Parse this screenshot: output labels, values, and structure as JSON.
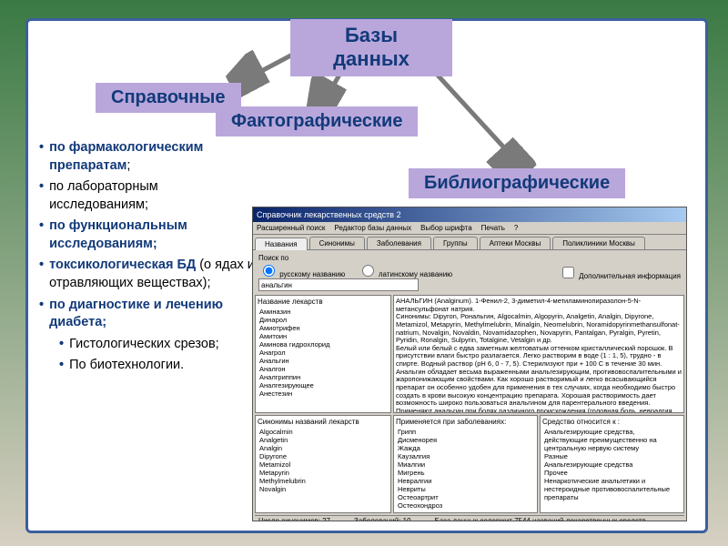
{
  "root": "Базы данных",
  "branches": {
    "reference": "Справочные",
    "fact": "Фактографические",
    "biblio": "Библиографические"
  },
  "bullets": [
    {
      "lead": "по фармакологическим препаратам",
      "tail": ";",
      "bold": true
    },
    {
      "lead": "",
      "tail": "по лабораторным исследованиям;",
      "bold": false
    },
    {
      "lead": "по функциональным исследованиям;",
      "tail": "",
      "bold": true
    },
    {
      "lead": "токсикологическая БД",
      "tail": " (о ядах и отравляющих веществах);",
      "bold": true
    },
    {
      "lead": "по диагностике и лечению диабета;",
      "tail": "",
      "bold": true
    }
  ],
  "sub_bullets": [
    "Гистологических срезов;",
    "По биотехнологии."
  ],
  "app": {
    "title": "Справочник лекарственных средств 2",
    "menu": [
      "Расширенный поиск",
      "Редактор базы данных",
      "Выбор шрифта",
      "Печать",
      "?"
    ],
    "tabs": [
      "Названия",
      "Синонимы",
      "Заболевания",
      "Группы",
      "Аптеки Москвы",
      "Поликлиники Москвы"
    ],
    "search_label": "Поиск по",
    "search_opt1": "русскому названию",
    "search_opt2": "латинскому названию",
    "search_opt3": "Дополнительная информация",
    "search_value": "анальгин",
    "list1_header": "Название лекарств",
    "list1": [
      "Аминазин",
      "Динарол",
      "Амиотрифен",
      "Амитоин",
      "Аминова гидрохлорид",
      "Анагрол",
      "Анальгин",
      "Аналгон",
      "Аналгриппин",
      "Аналгезирующее",
      "Анестезин"
    ],
    "list2_header": "Синонимы названий лекарств",
    "list2": [
      "Algocalmin",
      "Analgetin",
      "Analgin",
      "Dipyrone",
      "Metamizol",
      "Metapyrin",
      "Methylmelubrin",
      "Novalgin"
    ],
    "desc": "АНАЛЬГИН (Analginum). 1-Фенил-2, 3-диметил-4-метиламинопиразолон-5-N-метансульфонат натрия.\nСинонимы: Dipyron, Рональгин, Algocalmin, Algopyrin, Analgetin, Analgin, Dipyrone, Metamizol, Metapyrin, Methylmelubrin, Minalgin, Neomelubrin, Noramidopyrinmethansulfonat-natrium, Novalgin, Novaldin, Novamidazophen, Novapyrin, Pantalgan, Pyralgin, Pyretin, Pyridin, Ronalgin, Sulpyrin, Totalgine, Vetalgin и др.\nБелый или белый с едва заметным желтоватым оттенком кристаллический порошок. В присутствии влаги быстро разлагается. Легко растворим в воде (1 : 1, 5), трудно - в спирте. Водный раствор (pH 6, 0 - 7, 5). Стерилизуют при + 100 С в течение 30 мин.\nАнальгин обладает весьма выраженными анальгезирующим, противовоспалительными и жаропонижающим свойствами. Как хорошо растворимый и легко всасывающийся препарат он особенно удобен для применения в тех случаях, когда необходимо быстро создать в крови высокую концентрацию препарата. Хорошая растворимость дает возможность широко пользоваться анальгином для парентерального введения.\nПрименяют анальгин при болях различного происхождения (головная боль, невралгия, радикулиты, миозиты), лихорадочных состояниях, гриппе, ревматизме, хорее.",
    "uses_header": "Применяется при заболеваниях:",
    "uses": [
      "Грипп",
      "Дисменорея",
      "Жажда",
      "Каузалгия",
      "Миалгии",
      "Мигрень",
      "Невралгии",
      "Невриты",
      "Остеоартрит",
      "Остеохондроз"
    ],
    "groups_header": "Средство относится к :",
    "groups": [
      "Анальгезирующие средства, действующие преимущественно на центральную нервую систему",
      "Разные",
      "   Анальгезирующие средства",
      "Прочее",
      "   Ненаркотические анальгетики и нестероидные противовоспалительные препараты"
    ],
    "status_syn": "Число синонимов: 27",
    "status_dis": "Заболеваний: 10",
    "status_db": "База данных содержит 7544 названий лекарственных средств"
  }
}
